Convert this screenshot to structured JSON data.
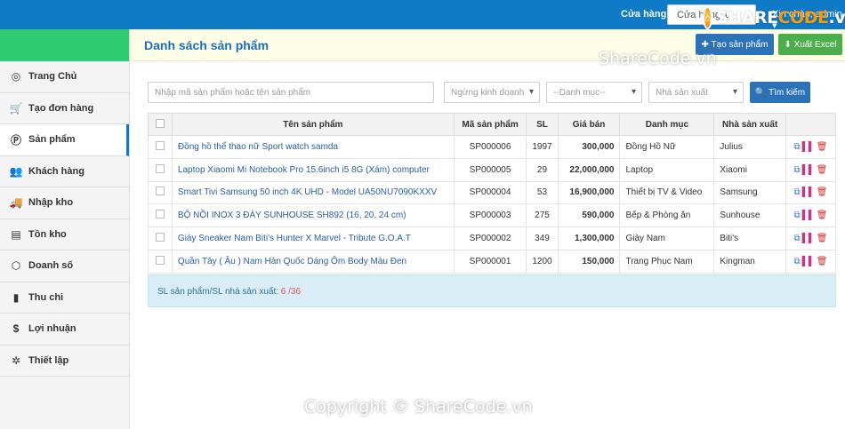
{
  "topbar": {
    "store_label": "Cửa hàng",
    "store_select_value": "Cửa hàng 1",
    "user_greeting": "Xin chào, admin ▾",
    "logo_text_main": "SHARE",
    "logo_text_accent": "CODE",
    "logo_text_suffix": ".vn"
  },
  "sidebar": {
    "items": [
      {
        "label": "Trang Chủ",
        "icon": "◎"
      },
      {
        "label": "Tạo đơn hàng",
        "icon": "🛒"
      },
      {
        "label": "Sản phẩm",
        "icon": "Ⓟ"
      },
      {
        "label": "Khách hàng",
        "icon": "👥"
      },
      {
        "label": "Nhập kho",
        "icon": "🚚"
      },
      {
        "label": "Tồn kho",
        "icon": "▤"
      },
      {
        "label": "Doanh số",
        "icon": "⬡"
      },
      {
        "label": "Thu chi",
        "icon": "▮"
      },
      {
        "label": "Lợi nhuận",
        "icon": "$"
      },
      {
        "label": "Thiết lập",
        "icon": "✲"
      }
    ]
  },
  "header": {
    "title": "Danh sách sản phẩm",
    "create_label": "✚ Tạo sản phẩm",
    "excel_label": "⬇ Xuất Excel"
  },
  "watermark_top": "ShareCode.vn",
  "filters": {
    "search_placeholder": "Nhập mã sản phẩm hoặc tên sản phẩm",
    "trade_value": "Ngừng kinh doanh",
    "category_value": "--Danh mục--",
    "manufacturer_value": "Nhà sản xuất",
    "search_button": "🔍 Tìm kiếm"
  },
  "table": {
    "columns": [
      "",
      "Tên sản phẩm",
      "Mã sản phẩm",
      "SL",
      "Giá bán",
      "Danh mục",
      "Nhà sản xuất",
      ""
    ],
    "rows": [
      {
        "name": "Đồng hồ thể thao nữ Sport watch samda",
        "code": "SP000006",
        "qty": "1997",
        "price": "300,000",
        "category": "Đồng Hồ Nữ",
        "maker": "Julius"
      },
      {
        "name": "Laptop Xiaomi Mi Notebook Pro 15.6inch i5 8G (Xám) computer",
        "code": "SP000005",
        "qty": "29",
        "price": "22,000,000",
        "category": "Laptop",
        "maker": "Xiaomi"
      },
      {
        "name": "Smart Tivi Samsung 50 inch 4K UHD - Model UA50NU7090KXXV",
        "code": "SP000004",
        "qty": "53",
        "price": "16,900,000",
        "category": "Thiết bị TV & Video",
        "maker": "Samsung"
      },
      {
        "name": "BỘ NỒI INOX 3 ĐÁY SUNHOUSE SH892 (16, 20, 24 cm)",
        "code": "SP000003",
        "qty": "275",
        "price": "590,000",
        "category": "Bếp & Phòng ăn",
        "maker": "Sunhouse"
      },
      {
        "name": "Giày Sneaker Nam Biti's Hunter X Marvel - Tribute G.O.A.T",
        "code": "SP000002",
        "qty": "349",
        "price": "1,300,000",
        "category": "Giày Nam",
        "maker": "Biti's"
      },
      {
        "name": "Quần Tây ( Âu ) Nam Hàn Quốc Dáng Ôm Body Màu Đen",
        "code": "SP000001",
        "qty": "1200",
        "price": "150,000",
        "category": "Trang Phục Nam",
        "maker": "Kingman"
      }
    ]
  },
  "summary": {
    "label": "SL sản phẩm/SL nhà sản xuất: ",
    "count": "6 /36"
  },
  "watermark_bottom": "Copyright © ShareCode.vn",
  "colors": {
    "topbar": "#0f7ac6",
    "brand": "#2ecc71",
    "title": "#1d6fb5",
    "excel": "#4cae4c"
  }
}
